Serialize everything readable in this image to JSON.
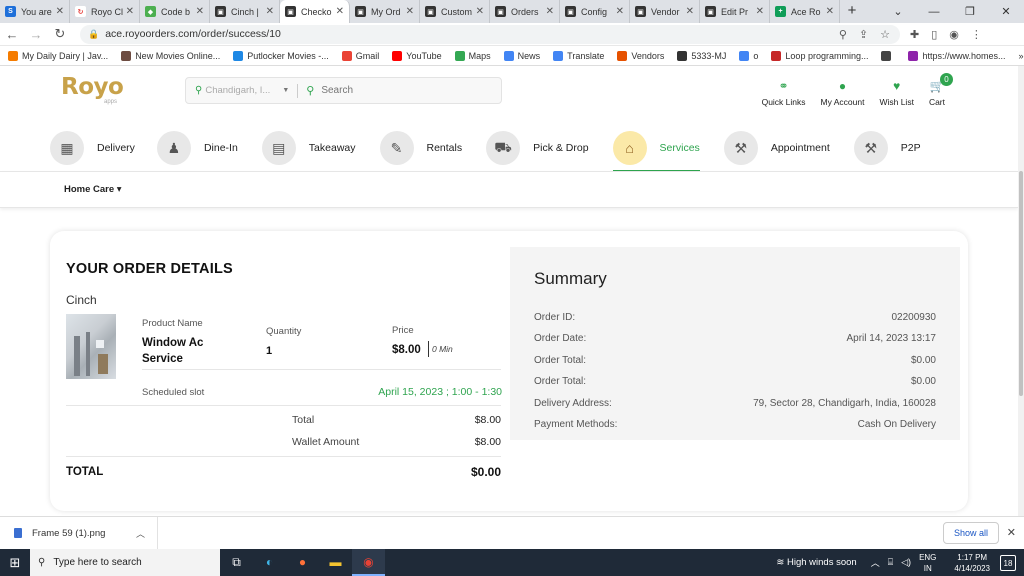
{
  "browser": {
    "tabs": [
      {
        "title": "You are",
        "color": "#1e6fd9",
        "glyph": "S"
      },
      {
        "title": "Royo Cl",
        "color": "#ffffff",
        "glyph": "↻"
      },
      {
        "title": "Code b",
        "color": "#4caf50",
        "glyph": "◆"
      },
      {
        "title": "Cinch |",
        "color": "#333333",
        "glyph": "▣"
      },
      {
        "title": "Checko",
        "color": "#333333",
        "glyph": "▣"
      },
      {
        "title": "My Ord",
        "color": "#333333",
        "glyph": "▣"
      },
      {
        "title": "Custom",
        "color": "#333333",
        "glyph": "▣"
      },
      {
        "title": "Orders",
        "color": "#333333",
        "glyph": "▣"
      },
      {
        "title": "Config",
        "color": "#333333",
        "glyph": "▣"
      },
      {
        "title": "Vendor",
        "color": "#333333",
        "glyph": "▣"
      },
      {
        "title": "Edit Pr",
        "color": "#333333",
        "glyph": "▣"
      },
      {
        "title": "Ace Ro",
        "color": "#0f9d58",
        "glyph": "+"
      }
    ],
    "url": "ace.royoorders.com/order/success/10",
    "bookmarks": [
      {
        "label": "My Daily Dairy | Jav...",
        "color": "#f57c00"
      },
      {
        "label": "New Movies Online...",
        "color": "#6d4c41"
      },
      {
        "label": "Putlocker Movies -...",
        "color": "#1e88e5"
      },
      {
        "label": "Gmail",
        "color": "#ea4335"
      },
      {
        "label": "YouTube",
        "color": "#ff0000"
      },
      {
        "label": "Maps",
        "color": "#34a853"
      },
      {
        "label": "News",
        "color": "#4285f4"
      },
      {
        "label": "Translate",
        "color": "#4285f4"
      },
      {
        "label": "Vendors",
        "color": "#e65100"
      },
      {
        "label": "5333-MJ",
        "color": "#333333"
      },
      {
        "label": "o",
        "color": "#4285f4"
      },
      {
        "label": "Loop programming...",
        "color": "#c62828"
      },
      {
        "label": "",
        "color": "#444444"
      },
      {
        "label": "https://www.homes...",
        "color": "#8e24aa"
      }
    ]
  },
  "header": {
    "logo": "Royo",
    "logo_sub": "apps",
    "location_text": "Chandigarh, I...",
    "search_placeholder": "Search",
    "links": [
      {
        "label": "Quick Links",
        "icon": "link-icon",
        "glyph": "⚭"
      },
      {
        "label": "My Account",
        "icon": "user-icon",
        "glyph": "●"
      },
      {
        "label": "Wish List",
        "icon": "heart-icon",
        "glyph": "♥"
      },
      {
        "label": "Cart",
        "icon": "cart-icon",
        "glyph": "🛒"
      }
    ],
    "cart_count": "0",
    "accent_color": "#2fa44f"
  },
  "categories": [
    {
      "label": "Delivery",
      "glyph": "▦"
    },
    {
      "label": "Dine-In",
      "glyph": "♟"
    },
    {
      "label": "Takeaway",
      "glyph": "▤"
    },
    {
      "label": "Rentals",
      "glyph": "✎"
    },
    {
      "label": "Pick & Drop",
      "glyph": "⛟"
    },
    {
      "label": "Services",
      "glyph": "⌂"
    },
    {
      "label": "Appointment",
      "glyph": "⚒"
    },
    {
      "label": "P2P",
      "glyph": "⚒"
    }
  ],
  "active_category": "Services",
  "subnav": {
    "item": "Home Care ▾"
  },
  "order": {
    "heading": "YOUR ORDER DETAILS",
    "vendor": "Cinch",
    "col_product": "Product Name",
    "col_quantity": "Quantity",
    "col_price": "Price",
    "product_name": "Window Ac Service",
    "quantity": "1",
    "price": "$8.00",
    "duration": "0 Min",
    "slot_label": "Scheduled slot",
    "slot_value": "April 15, 2023 ; 1:00 - 1:30",
    "total_label": "Total",
    "total_value": "$8.00",
    "wallet_label": "Wallet Amount",
    "wallet_value": "$8.00",
    "grand_label": "TOTAL",
    "grand_value": "$0.00"
  },
  "summary": {
    "heading": "Summary",
    "rows": [
      {
        "label": "Order ID:",
        "value": "02200930"
      },
      {
        "label": "Order Date:",
        "value": "April 14, 2023 13:17"
      },
      {
        "label": "Order Total:",
        "value": "$0.00"
      },
      {
        "label": "Order Total:",
        "value": "$0.00"
      },
      {
        "label": "Delivery Address:",
        "value": "79, Sector 28, Chandigarh, India, 160028"
      },
      {
        "label": "Payment Methods:",
        "value": "Cash On Delivery"
      }
    ]
  },
  "downloads": {
    "file": "Frame 59 (1).png",
    "show_all": "Show all"
  },
  "taskbar": {
    "search_placeholder": "Type here to search",
    "weather": "High winds soon",
    "lang_1": "ENG",
    "lang_2": "IN",
    "time": "1:17 PM",
    "date": "4/14/2023",
    "notif_count": "18"
  }
}
